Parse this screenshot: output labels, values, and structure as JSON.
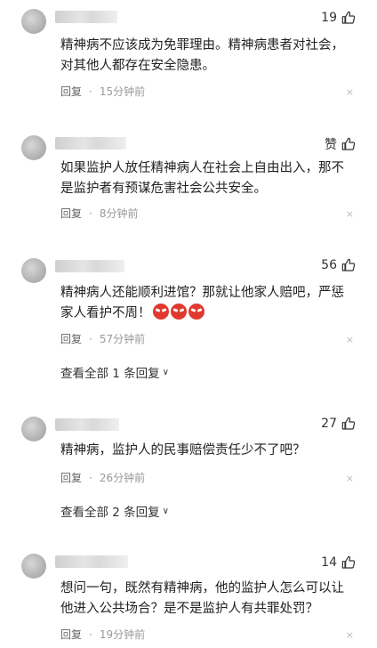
{
  "comments": [
    {
      "likes": "19",
      "text": "精神病不应该成为免罪理由。精神病患者对社会，对其他人都存在安全隐患。",
      "reply_label": "回复",
      "time": "15分钟前",
      "close": "×"
    },
    {
      "likes": "赞",
      "text": "如果监护人放任精神病人在社会上自由出入，那不是监护者有预谋危害社会公共安全。",
      "reply_label": "回复",
      "time": "8分钟前",
      "close": "×"
    },
    {
      "likes": "56",
      "text": "精神病人还能顺利进馆？那就让他家人赔吧，严惩家人看护不周！",
      "reply_label": "回复",
      "time": "57分钟前",
      "close": "×",
      "view_all": "查看全部 1 条回复"
    },
    {
      "likes": "27",
      "text": "精神病，监护人的民事赔偿责任少不了吧？",
      "reply_label": "回复",
      "time": "26分钟前",
      "close": "×",
      "view_all": "查看全部 2 条回复"
    },
    {
      "likes": "14",
      "text": "想问一句，既然有精神病，他的监护人怎么可以让他进入公共场合？是不是监护人有共罪处罚？",
      "reply_label": "回复",
      "time": "19分钟前",
      "close": "×"
    }
  ],
  "icons": {
    "like": "thumbs-up-icon",
    "close": "close-icon",
    "chevron": "chevron-down-icon"
  },
  "emoji": {
    "count": 3,
    "name": "angry-face-emoji"
  }
}
